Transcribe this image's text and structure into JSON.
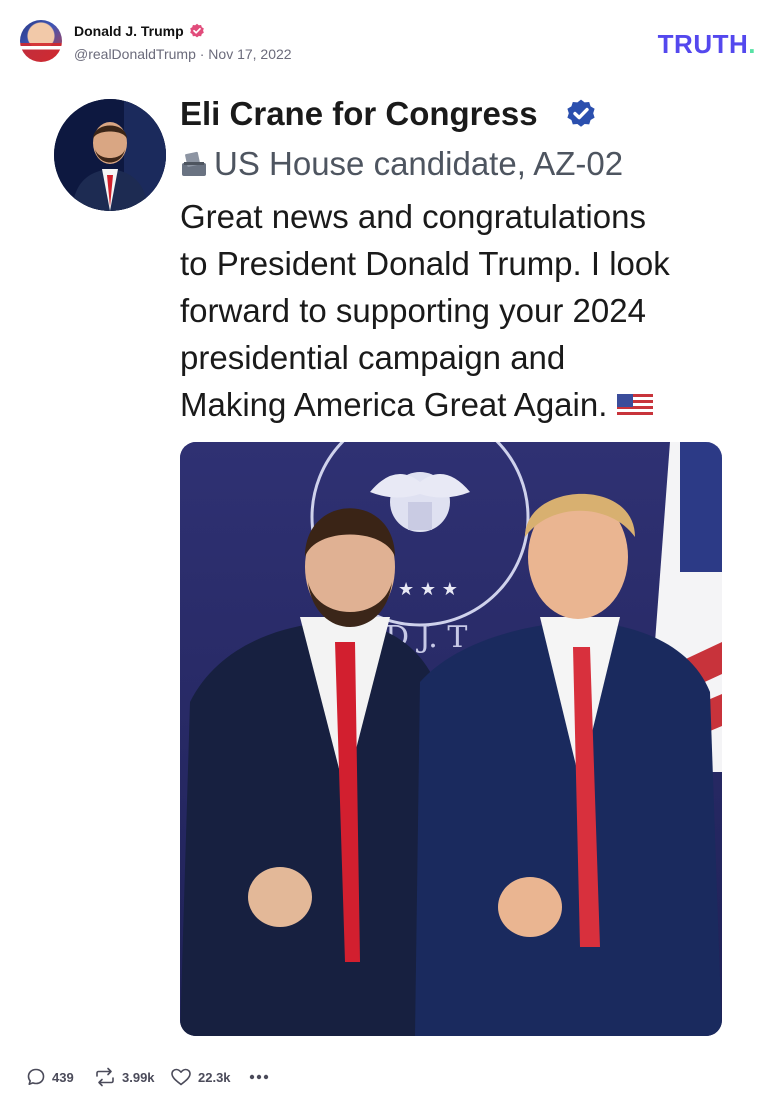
{
  "post": {
    "author_name": "Donald J. Trump",
    "author_handle_date": "@realDonaldTrump · Nov 17, 2022",
    "brand": "TRUTH",
    "brand_dot": "."
  },
  "embedded": {
    "name": "Eli Crane for Congress",
    "subtitle": "US House candidate, AZ-02",
    "text_lines": [
      "Great news and congratulations",
      "to President Donald Trump. I look",
      "forward to supporting your 2024",
      "presidential campaign and",
      "Making America Great Again."
    ],
    "photo_text": "D J. T"
  },
  "actions": {
    "replies": "439",
    "retruths": "3.99k",
    "likes": "22.3k"
  },
  "colors": {
    "brand_purple": "#5448ee",
    "brand_green": "#57e2a5",
    "verified_pink": "#e14c7b",
    "verified_blue": "#2b4fae"
  },
  "icons": [
    "verified-badge-icon",
    "ballot-box-icon",
    "us-flag-icon",
    "reply-icon",
    "retruth-icon",
    "like-icon",
    "more-icon"
  ]
}
